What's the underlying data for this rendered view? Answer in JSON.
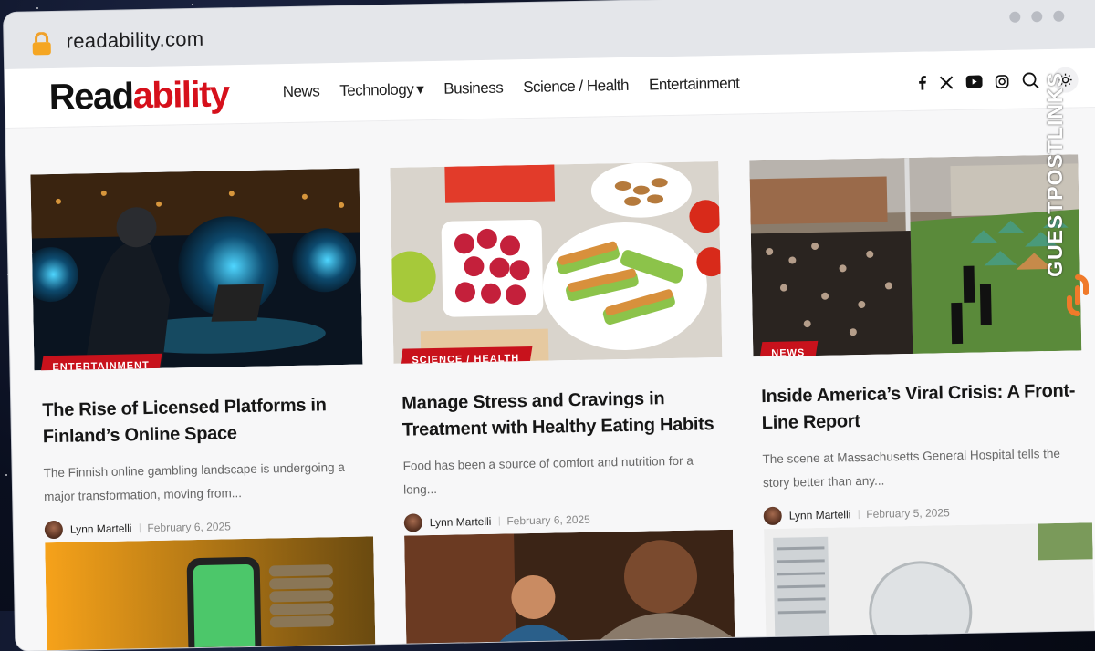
{
  "browser": {
    "url": "readability.com"
  },
  "site": {
    "logo_part1": "Read",
    "logo_part2": "ability",
    "nav": [
      "News",
      "Technology",
      "Business",
      "Science / Health",
      "Entertainment"
    ],
    "social_icons": [
      "facebook-icon",
      "x-icon",
      "youtube-icon",
      "instagram-icon",
      "search-icon",
      "sun-icon"
    ]
  },
  "posts": [
    {
      "category": "ENTERTAINMENT",
      "title": "The Rise of Licensed Platforms in Finland’s Online Space",
      "excerpt": "The Finnish online gambling landscape is undergoing a major transformation, moving from...",
      "author": "Lynn Martelli",
      "date": "February 6, 2025"
    },
    {
      "category": "SCIENCE / HEALTH",
      "title": "Manage Stress and Cravings in Treatment with Healthy Eating Habits",
      "excerpt": "Food has been a source of comfort and nutrition for a long...",
      "author": "Lynn Martelli",
      "date": "February 6, 2025"
    },
    {
      "category": "NEWS",
      "title": "Inside America’s Viral Crisis: A Front-Line Report",
      "excerpt": "The scene at Massachusetts General Hospital tells the story better than any...",
      "author": "Lynn Martelli",
      "date": "February 5, 2025"
    }
  ],
  "watermark": "GUESTPOSTLINKS",
  "colors": {
    "accent": "#c8121c",
    "logo_red": "#d6101b"
  }
}
